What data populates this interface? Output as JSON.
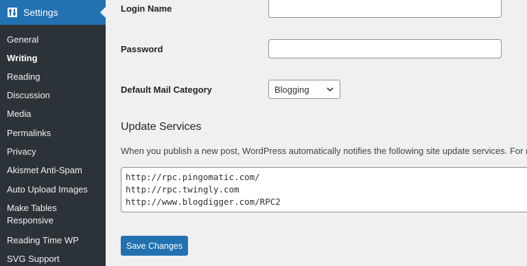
{
  "sidebar": {
    "header_label": "Settings",
    "header_icon": "settings-sliders-icon",
    "items": [
      {
        "label": "General"
      },
      {
        "label": "Writing"
      },
      {
        "label": "Reading"
      },
      {
        "label": "Discussion"
      },
      {
        "label": "Media"
      },
      {
        "label": "Permalinks"
      },
      {
        "label": "Privacy"
      },
      {
        "label": "Akismet Anti-Spam"
      },
      {
        "label": "Auto Upload Images"
      },
      {
        "label": "Make Tables"
      },
      {
        "label": "Responsive"
      },
      {
        "label": "Reading Time WP"
      },
      {
        "label": "SVG Support"
      }
    ],
    "current_item": "Writing"
  },
  "form": {
    "login_name_label": "Login Name",
    "login_name_value": "",
    "password_label": "Password",
    "password_value": "",
    "mail_category_label": "Default Mail Category",
    "mail_category_value": "Blogging"
  },
  "update_services": {
    "title": "Update Services",
    "description": "When you publish a new post, WordPress automatically notifies the following site update services. For mor",
    "services": [
      "http://rpc.pingomatic.com/",
      "http://rpc.twingly.com",
      "http://www.blogdigger.com/RPC2"
    ]
  },
  "buttons": {
    "save_label": "Save Changes"
  },
  "colors": {
    "sidebar_bg": "#1d2327",
    "accent": "#2271b1",
    "page_bg": "#f0f0f1"
  }
}
